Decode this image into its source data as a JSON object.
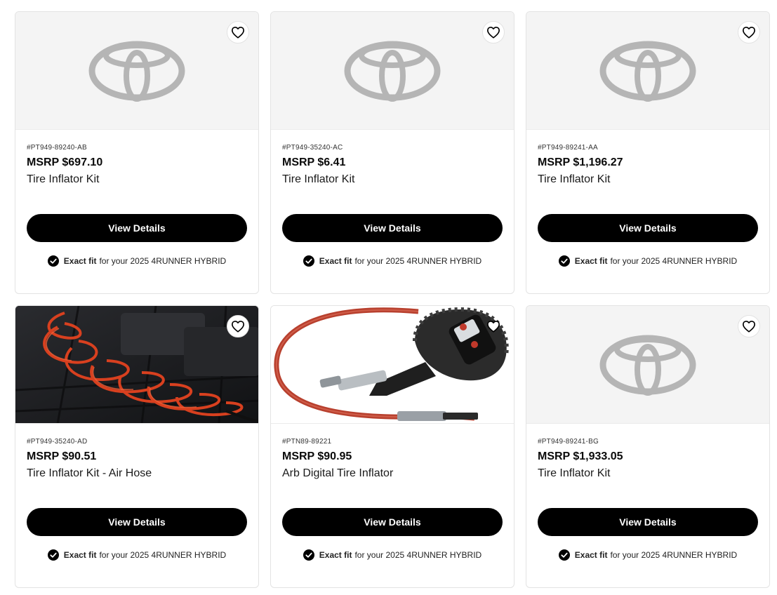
{
  "products": [
    {
      "part": "#PT949-89240-AB",
      "price": "MSRP $697.10",
      "name": "Tire Inflator Kit",
      "button": "View Details",
      "fit_strong": "Exact fit",
      "fit_text": "for your 2025 4RUNNER HYBRID",
      "image": "toyota-logo-placeholder"
    },
    {
      "part": "#PT949-35240-AC",
      "price": "MSRP $6.41",
      "name": "Tire Inflator Kit",
      "button": "View Details",
      "fit_strong": "Exact fit",
      "fit_text": "for your 2025 4RUNNER HYBRID",
      "image": "toyota-logo-placeholder"
    },
    {
      "part": "#PT949-89241-AA",
      "price": "MSRP $1,196.27",
      "name": "Tire Inflator Kit",
      "button": "View Details",
      "fit_strong": "Exact fit",
      "fit_text": "for your 2025 4RUNNER HYBRID",
      "image": "toyota-logo-placeholder"
    },
    {
      "part": "#PT949-35240-AD",
      "price": "MSRP $90.51",
      "name": "Tire Inflator Kit - Air Hose",
      "button": "View Details",
      "fit_strong": "Exact fit",
      "fit_text": "for your 2025 4RUNNER HYBRID",
      "image": "coiled-air-hose-photo"
    },
    {
      "part": "#PTN89-89221",
      "price": "MSRP $90.95",
      "name": "Arb Digital Tire Inflator",
      "button": "View Details",
      "fit_strong": "Exact fit",
      "fit_text": "for your 2025 4RUNNER HYBRID",
      "image": "digital-tire-inflator-photo"
    },
    {
      "part": "#PT949-89241-BG",
      "price": "MSRP $1,933.05",
      "name": "Tire Inflator Kit",
      "button": "View Details",
      "fit_strong": "Exact fit",
      "fit_text": "for your 2025 4RUNNER HYBRID",
      "image": "toyota-logo-placeholder"
    }
  ],
  "icons": {
    "favorite": "heart-outline-icon",
    "fit": "check-circle-icon"
  },
  "colors": {
    "button_bg": "#000000",
    "logo_gray": "#b5b5b5",
    "media_bg": "#f4f4f4"
  }
}
